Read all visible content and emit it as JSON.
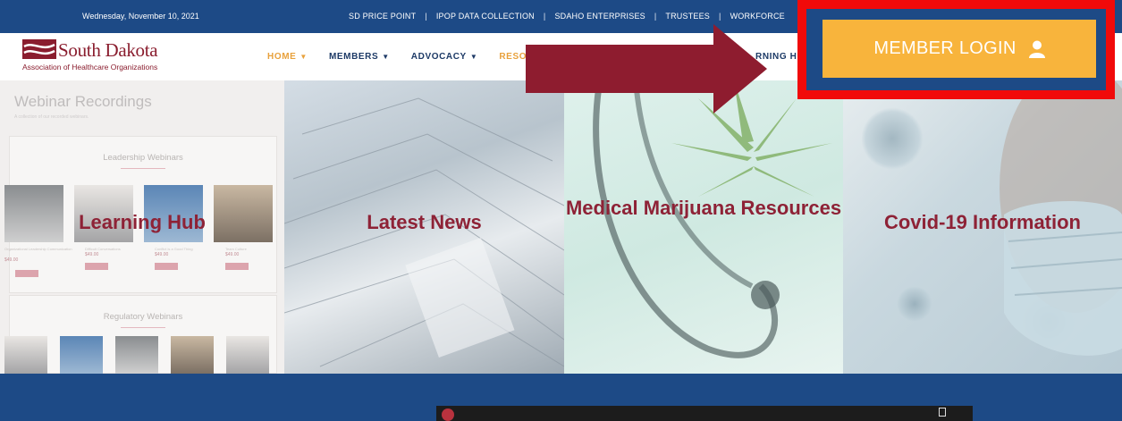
{
  "topbar": {
    "date": "Wednesday, November 10, 2021",
    "links": [
      "SD PRICE POINT",
      "IPOP DATA COLLECTION",
      "SDAHO ENTERPRISES",
      "TRUSTEES",
      "WORKFORCE"
    ]
  },
  "logo": {
    "name": "South Dakota",
    "subtitle": "Association of Healthcare Organizations"
  },
  "nav": {
    "items": [
      {
        "label": "HOME"
      },
      {
        "label": "MEMBERS"
      },
      {
        "label": "ADVOCACY"
      },
      {
        "label": "RESOU"
      }
    ],
    "right_partial": "RNING HU"
  },
  "login": {
    "label": "MEMBER LOGIN",
    "icon": "user-icon",
    "outline_color": "#f10a0a",
    "button_color": "#f8b43c"
  },
  "learning_hub_preview": {
    "title": "Webinar Recordings",
    "subtitle": "A collection of our recorded webinars.",
    "leadership_heading": "Leadership Webinars",
    "regulatory_heading": "Regulatory Webinars",
    "products": [
      {
        "caption": "Organizational Leadership Communication",
        "price": "$49.00"
      },
      {
        "caption": "Difficult Conversations",
        "price": "$49.00"
      },
      {
        "caption": "Conflict is a Good Thing",
        "price": "$49.00"
      },
      {
        "caption": "Team Culture",
        "price": "$49.00"
      }
    ]
  },
  "tiles": [
    {
      "title": "Learning Hub"
    },
    {
      "title": "Latest News"
    },
    {
      "title": "Medical Marijuana Resources"
    },
    {
      "title": "Covid-19 Information"
    }
  ],
  "colors": {
    "brand_blue": "#1d4a86",
    "caption_red": "#8e2236",
    "arrow": "#8e1c2f"
  }
}
